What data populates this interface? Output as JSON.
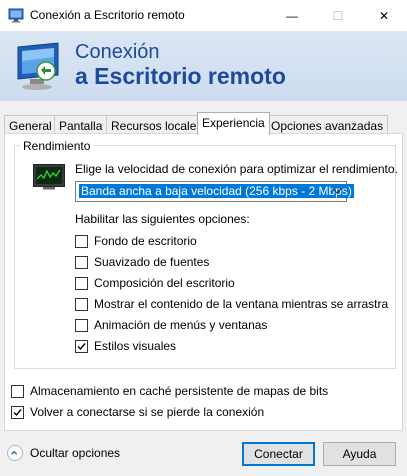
{
  "window": {
    "title": "Conexión a Escritorio remoto",
    "minimize_glyph": "—",
    "maximize_glyph": "☐",
    "close_glyph": "✕"
  },
  "banner": {
    "line1": "Conexión",
    "line2": "a Escritorio remoto"
  },
  "tabs": [
    {
      "label": "General"
    },
    {
      "label": "Pantalla"
    },
    {
      "label": "Recursos locales"
    },
    {
      "label": "Experiencia",
      "active": true
    },
    {
      "label": "Opciones avanzadas"
    }
  ],
  "performance": {
    "legend": "Rendimiento",
    "description": "Elige la velocidad de conexión para optimizar el rendimiento.",
    "speed_selected": "Banda ancha a baja velocidad (256 kbps - 2 Mbps)",
    "enable_label": "Habilitar las siguientes opciones:",
    "options": [
      {
        "label": "Fondo de escritorio",
        "checked": false
      },
      {
        "label": "Suavizado de fuentes",
        "checked": false
      },
      {
        "label": "Composición del escritorio",
        "checked": false
      },
      {
        "label": "Mostrar el contenido de la ventana mientras se arrastra",
        "checked": false
      },
      {
        "label": "Animación de menús y ventanas",
        "checked": false
      },
      {
        "label": "Estilos visuales",
        "checked": true
      }
    ]
  },
  "extra_options": [
    {
      "label": "Almacenamiento en caché persistente de mapas de bits",
      "checked": false
    },
    {
      "label": "Volver a conectarse si se pierde la conexión",
      "checked": true
    }
  ],
  "footer": {
    "hide_options": "Ocultar opciones",
    "connect": "Conectar",
    "help": "Ayuda"
  },
  "colors": {
    "accent": "#0078d7",
    "banner_text": "#1c4a9c"
  },
  "icons": {
    "app": "remote-desktop-icon",
    "performance": "performance-monitor-icon",
    "hide_options": "chevron-up-icon"
  }
}
